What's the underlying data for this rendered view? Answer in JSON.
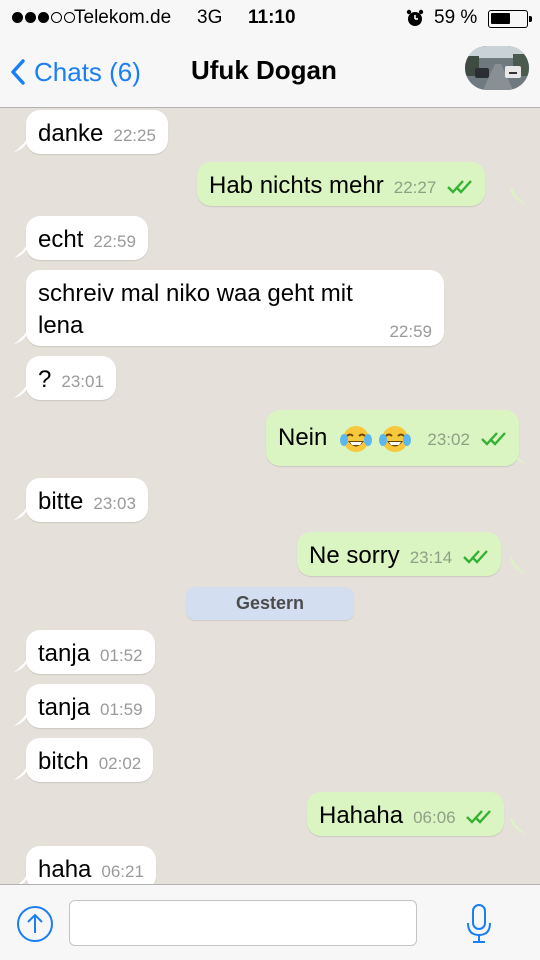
{
  "status_bar": {
    "carrier": "Telekom.de",
    "network": "3G",
    "time": "11:10",
    "battery_percent": "59 %",
    "battery_level": 0.59,
    "signal_bars_filled": 3,
    "signal_bars_total": 5
  },
  "nav": {
    "back_label": "Chats (6)",
    "title": "Ufuk Dogan"
  },
  "colors": {
    "accent": "#1a7ef5",
    "outgoing_bubble": "#dbf5c2",
    "incoming_bubble": "#ffffff",
    "chat_background": "#e5e1da",
    "read_check": "#34b233"
  },
  "messages": [
    {
      "dir": "in",
      "text": "danke",
      "time": "22:25"
    },
    {
      "dir": "out",
      "text": "Hab nichts mehr",
      "time": "22:27",
      "status": "read"
    },
    {
      "dir": "in",
      "text": "echt",
      "time": "22:59"
    },
    {
      "dir": "in",
      "text_line1": "schreiv mal niko waa geht mit",
      "text_line2": "lena",
      "time": "22:59"
    },
    {
      "dir": "in",
      "text": "?",
      "time": "23:01"
    },
    {
      "dir": "out",
      "text": "Nein",
      "emoji": "face-with-tears-of-joy x2",
      "time": "23:02",
      "status": "read"
    },
    {
      "dir": "in",
      "text": "bitte",
      "time": "23:03"
    },
    {
      "dir": "out",
      "text": "Ne sorry",
      "time": "23:14",
      "status": "read"
    },
    {
      "dir": "in",
      "text": "tanja",
      "time": "01:52"
    },
    {
      "dir": "in",
      "text": "tanja",
      "time": "01:59"
    },
    {
      "dir": "in",
      "text": "bitch",
      "time": "02:02"
    },
    {
      "dir": "out",
      "text": "Hahaha",
      "time": "06:06",
      "status": "read"
    },
    {
      "dir": "in",
      "text": "haha",
      "time": "06:21"
    }
  ],
  "day_divider": "Gestern",
  "input": {
    "placeholder": "",
    "value": "",
    "attach_icon": "upload-arrow-icon",
    "mic_icon": "microphone-icon"
  }
}
